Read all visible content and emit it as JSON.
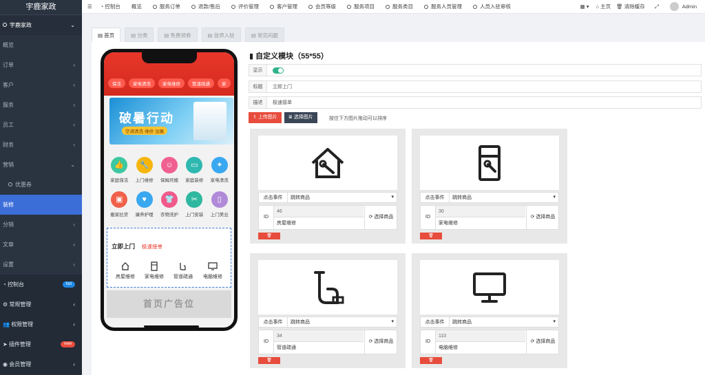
{
  "app": {
    "brand": "宇鹿家政"
  },
  "sidebar": {
    "section": "宇鹿家政",
    "items": [
      {
        "label": "概览"
      },
      {
        "label": "订单"
      },
      {
        "label": "客户"
      },
      {
        "label": "服务"
      },
      {
        "label": "员工"
      },
      {
        "label": "财务"
      },
      {
        "label": "营销"
      }
    ],
    "sub_item": "优惠券",
    "active": "装修",
    "items2": [
      {
        "label": "分销"
      },
      {
        "label": "文章"
      },
      {
        "label": "设置"
      }
    ],
    "bottom": [
      {
        "label": "控制台",
        "badge": "hot",
        "badge_color": "#1e88e5"
      },
      {
        "label": "常规管理"
      },
      {
        "label": "权限管理"
      },
      {
        "label": "插件管理",
        "badge": "new",
        "badge_color": "#e74c3c"
      },
      {
        "label": "会员管理"
      }
    ]
  },
  "topbar": {
    "items": [
      "控制台",
      "概览",
      "服务订单",
      "退款/售后",
      "评价管理",
      "客户管理",
      "会员等级",
      "服务项目",
      "服务类目",
      "服务人员管理",
      "人员入驻审核"
    ],
    "home": "主页",
    "clear": "清除缓存",
    "user": "Admin"
  },
  "tabs": [
    "首页",
    "分类",
    "免费领券",
    "技师入驻",
    "常见问题"
  ],
  "phone": {
    "chips": [
      "保洁",
      "家电清洗",
      "家电维修",
      "管道疏通",
      "家"
    ],
    "banner_title": "破暑行动",
    "banner_sub": "空调清洗·维修·加氟",
    "grid": [
      {
        "label": "家庭保洁",
        "color": "#3cc8a0"
      },
      {
        "label": "上门维修",
        "color": "#f5b50a"
      },
      {
        "label": "保姆月嫂",
        "color": "#f06090"
      },
      {
        "label": "家庭装修",
        "color": "#2fb8b0"
      },
      {
        "label": "家电清洗",
        "color": "#3aa8f0"
      },
      {
        "label": "搬家拉货",
        "color": "#f0604a"
      },
      {
        "label": "康养护理",
        "color": "#3aa8f0"
      },
      {
        "label": "衣物洗护",
        "color": "#f05a8a"
      },
      {
        "label": "上门安装",
        "color": "#2fb8a0"
      },
      {
        "label": "上门美业",
        "color": "#b08ad8"
      }
    ],
    "custom_title": "立即上门",
    "custom_sub": "极速接单",
    "custom_items": [
      "房屋维修",
      "家电维修",
      "管道疏通",
      "电脑维修"
    ],
    "ad": "首页广告位"
  },
  "editor": {
    "title": "自定义模块（55*55）",
    "show_label": "显示",
    "title_label": "标题",
    "title_value": "立即上门",
    "desc_label": "描述",
    "desc_value": "极速接单",
    "upload": "上传图片",
    "choose": "选择图片",
    "hint": "按住下方图片拖动可以排序",
    "event_label": "点击事件",
    "event_value": "跳转商品",
    "id_label": "ID",
    "pick": "选择商品",
    "cards": [
      {
        "id": "46",
        "name": "房屋维修"
      },
      {
        "id": "30",
        "name": "家电维修"
      },
      {
        "id": "34",
        "name": "管道疏通"
      },
      {
        "id": "110",
        "name": "电脑维修"
      }
    ]
  }
}
